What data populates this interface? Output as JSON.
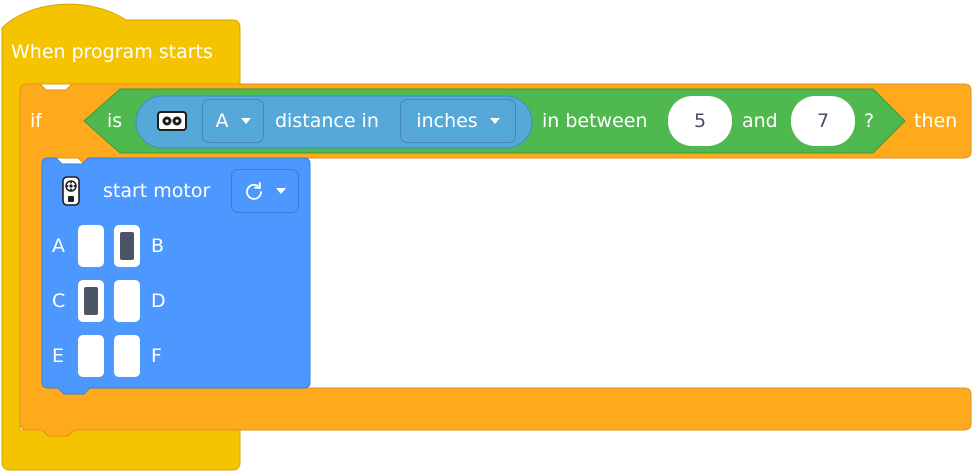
{
  "colors": {
    "hat": "#f5c400",
    "control": "#ffaa1d",
    "sensor": "#4fb84f",
    "distance": "#55a8d8",
    "motor": "#4c98fe"
  },
  "hat_block": {
    "label": "When program starts"
  },
  "if_block": {
    "if_label": "if",
    "then_label": "then"
  },
  "condition": {
    "is_label": "is",
    "sensor_icon": "distance-sensor-icon",
    "port_value": "A",
    "distance_label": "distance in",
    "unit_value": "inches",
    "between_label": "in between",
    "low_value": "5",
    "and_label": "and",
    "high_value": "7",
    "question_label": "?"
  },
  "motor_block": {
    "icon": "motor-icon",
    "label": "start motor",
    "direction_icon": "clockwise-arrow-icon",
    "ports": [
      {
        "name": "A",
        "selected": false
      },
      {
        "name": "B",
        "selected": true
      },
      {
        "name": "C",
        "selected": true
      },
      {
        "name": "D",
        "selected": false
      },
      {
        "name": "E",
        "selected": false
      },
      {
        "name": "F",
        "selected": false
      }
    ]
  }
}
